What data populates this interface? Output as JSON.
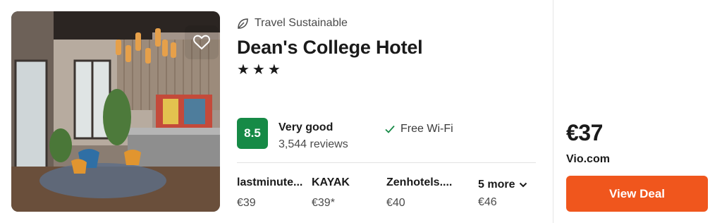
{
  "hotel": {
    "sustainability_label": "Travel Sustainable",
    "name": "Dean's College Hotel",
    "stars": "★★★",
    "star_count": 3,
    "score": "8.5",
    "rating_label": "Very good",
    "reviews": "3,544 reviews",
    "amenity": "Free Wi-Fi"
  },
  "providers": [
    {
      "name": "lastminute...",
      "price": "€39"
    },
    {
      "name": "KAYAK",
      "price": "€39*"
    },
    {
      "name": "Zenhotels....",
      "price": "€40"
    }
  ],
  "more": {
    "label": "5 more",
    "price": "€46"
  },
  "deal": {
    "price": "€37",
    "provider": "Vio.com",
    "button_label": "View Deal"
  },
  "colors": {
    "score_bg": "#168a46",
    "deal_button": "#f0561d"
  },
  "icons": {
    "favorite": "heart-icon",
    "sustainability": "leaf-icon",
    "amenity": "check-icon",
    "more": "chevron-down-icon"
  }
}
